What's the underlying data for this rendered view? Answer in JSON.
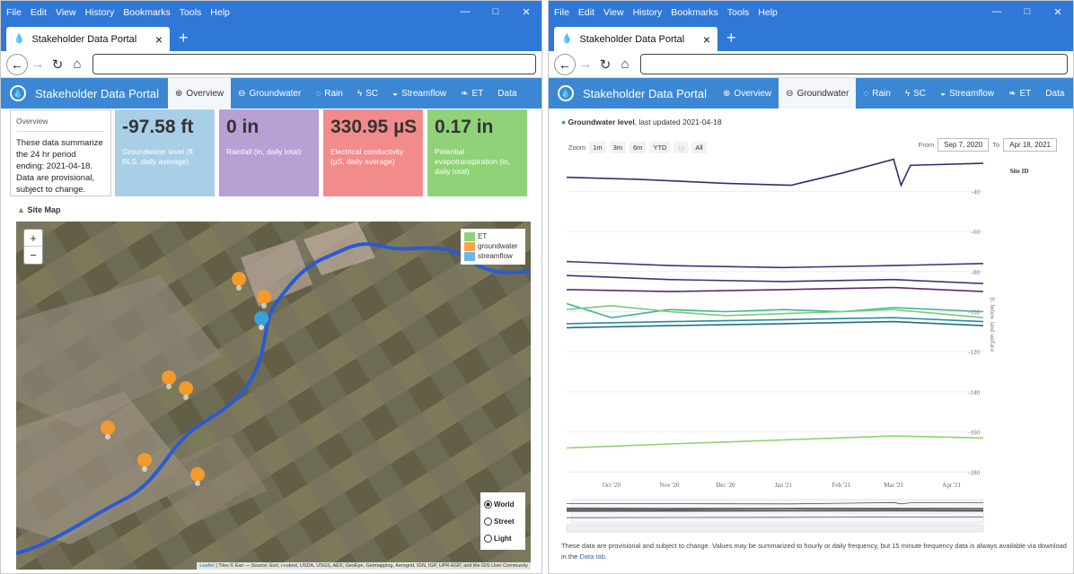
{
  "browser": {
    "menu": [
      "File",
      "Edit",
      "View",
      "History",
      "Bookmarks",
      "Tools",
      "Help"
    ],
    "tab_title": "Stakeholder Data Portal",
    "controls": {
      "minimize": "—",
      "maximize": "□",
      "close": "✕"
    }
  },
  "app": {
    "brand": "Stakeholder Data Portal",
    "nav": [
      {
        "label": "Overview",
        "icon": "globe-icon"
      },
      {
        "label": "Groundwater",
        "icon": "minus-circle-icon"
      },
      {
        "label": "Rain",
        "icon": "drop-icon"
      },
      {
        "label": "SC",
        "icon": "spark-icon"
      },
      {
        "label": "Streamflow",
        "icon": "tint-icon"
      },
      {
        "label": "ET",
        "icon": "leaf-icon"
      },
      {
        "label": "Data",
        "icon": ""
      }
    ]
  },
  "overview": {
    "header": "Overview",
    "text": "These data summarize the 24 hr period ending: 2021-04-18. Data are provisional, subject to change.",
    "cards": [
      {
        "value": "-97.58 ft",
        "label": "Groundwater level (ft BLS, daily average)",
        "color": "#a9cfe6"
      },
      {
        "value": "0 in",
        "label": "Rainfall (in, daily total)",
        "color": "#b89fd4"
      },
      {
        "value": "330.95 µS",
        "label": "Electrical conductivity (µS, daily average)",
        "color": "#f28b8b"
      },
      {
        "value": "0.17 in",
        "label": "Potential evapotranspiration (in, daily total)",
        "color": "#8fd277"
      }
    ],
    "sitemap_title": "Site Map",
    "zoom_in": "+",
    "zoom_out": "−",
    "legend": [
      {
        "label": "ET",
        "color": "#8fd277"
      },
      {
        "label": "groundwater",
        "color": "#f5a54a"
      },
      {
        "label": "streamflow",
        "color": "#6ab7e6"
      }
    ],
    "basemaps": [
      {
        "label": "World",
        "selected": true
      },
      {
        "label": "Street",
        "selected": false
      },
      {
        "label": "Light",
        "selected": false
      }
    ],
    "attribution_link": "Leaflet",
    "attribution_text": " | Tiles © Esri — Source: Esri, i-cubed, USDA, USGS, AEX, GeoEye, Getmapping, Aerogrid, IGN, IGP, UPR-EGP, and the GIS User Community"
  },
  "groundwater": {
    "title_bold": "Groundwater level",
    "title_rest": ", last updated 2021-04-18",
    "zoom_label": "Zoom",
    "zoom_buttons": [
      "1m",
      "3m",
      "6m",
      "YTD",
      "1y",
      "All"
    ],
    "from_label": "From",
    "from_value": "Sep 7, 2020",
    "to_label": "To",
    "to_value": "Apr 18, 2021",
    "footnote": "These data are provisional and subject to change. Values may be summarized to hourly or daily frequency, but 15 minute frequency data is always available via download in the ",
    "footnote_link": "Data tab",
    "footnote_end": "."
  },
  "chart_data": {
    "type": "line",
    "title": "",
    "xlabel": "",
    "ylabel": "ft. below land surface",
    "legend_title": "Site ID",
    "x_ticks": [
      "Oct '20",
      "Nov '20",
      "Dec '20",
      "Jan '21",
      "Feb '21",
      "Mar '21",
      "Apr '21"
    ],
    "x_range": [
      "2020-09-07",
      "2021-04-18"
    ],
    "y_ticks": [
      -40,
      -60,
      -80,
      -100,
      -120,
      -140,
      -160,
      -180
    ],
    "ylim": [
      -183,
      -30
    ],
    "grid": true,
    "series": [
      {
        "color": "#3b2a6b",
        "x": [
          "2020-09-07",
          "2020-10-15",
          "2020-12-01",
          "2021-01-05",
          "2021-02-01",
          "2021-03-01",
          "2021-03-05",
          "2021-03-10",
          "2021-04-18"
        ],
        "y": [
          -33,
          -34,
          -36,
          -37,
          -31,
          -24,
          -37,
          -27,
          -26
        ]
      },
      {
        "color": "#4a2f7a",
        "x": [
          "2020-09-07",
          "2020-11-01",
          "2021-01-01",
          "2021-03-01",
          "2021-04-18"
        ],
        "y": [
          -75,
          -77,
          -78,
          -77,
          -76
        ]
      },
      {
        "color": "#35397a",
        "x": [
          "2020-09-07",
          "2020-11-01",
          "2021-01-01",
          "2021-03-01",
          "2021-04-18"
        ],
        "y": [
          -82,
          -84,
          -85,
          -84,
          -86
        ]
      },
      {
        "color": "#5a2a6b",
        "x": [
          "2020-09-07",
          "2020-11-01",
          "2021-01-01",
          "2021-03-01",
          "2021-04-18"
        ],
        "y": [
          -89,
          -90,
          -89,
          -88,
          -90
        ]
      },
      {
        "color": "#3fb59a",
        "x": [
          "2020-09-07",
          "2020-10-01",
          "2020-11-01",
          "2020-12-01",
          "2021-01-01",
          "2021-02-01",
          "2021-03-01",
          "2021-04-18"
        ],
        "y": [
          -96,
          -103,
          -99,
          -100,
          -99,
          -100,
          -98,
          -100
        ]
      },
      {
        "color": "#7cc97a",
        "x": [
          "2020-09-07",
          "2020-10-01",
          "2020-11-01",
          "2020-12-01",
          "2021-01-01",
          "2021-02-01",
          "2021-03-01",
          "2021-04-18"
        ],
        "y": [
          -99,
          -97,
          -100,
          -102,
          -101,
          -100,
          -99,
          -103
        ]
      },
      {
        "color": "#2a8aa0",
        "x": [
          "2020-09-07",
          "2020-11-01",
          "2021-01-01",
          "2021-03-01",
          "2021-04-18"
        ],
        "y": [
          -106,
          -105,
          -104,
          -103,
          -105
        ]
      },
      {
        "color": "#1f6f8b",
        "x": [
          "2020-09-07",
          "2020-11-01",
          "2021-01-01",
          "2021-03-01",
          "2021-04-18"
        ],
        "y": [
          -108,
          -107,
          -106,
          -105,
          -107
        ]
      },
      {
        "color": "#8dd46a",
        "x": [
          "2020-09-07",
          "2020-11-01",
          "2021-01-01",
          "2021-03-01",
          "2021-04-18"
        ],
        "y": [
          -168,
          -166,
          -164,
          -162,
          -163
        ]
      }
    ]
  }
}
